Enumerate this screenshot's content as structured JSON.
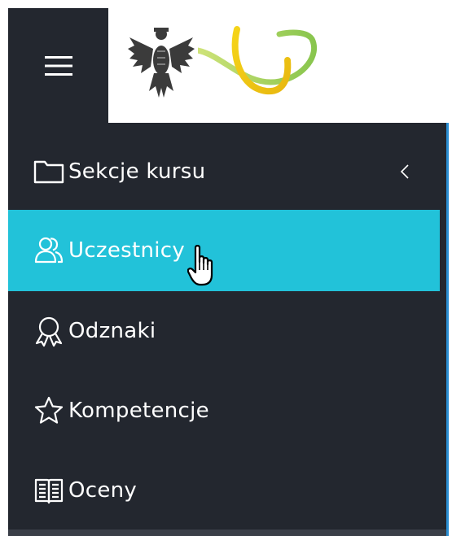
{
  "header": {
    "menu_toggle": "hamburger-menu-icon"
  },
  "sidebar": {
    "items": [
      {
        "label": "Sekcje kursu",
        "icon": "folder-icon",
        "has_chevron": true
      },
      {
        "label": "Uczestnicy",
        "icon": "users-icon",
        "active": true
      },
      {
        "label": "Odznaki",
        "icon": "badge-icon"
      },
      {
        "label": "Kompetencje",
        "icon": "star-icon"
      },
      {
        "label": "Oceny",
        "icon": "book-icon"
      }
    ]
  },
  "colors": {
    "sidebar_bg": "#23272f",
    "active_bg": "#22c2d9",
    "accent_line": "#2a8fd4",
    "text": "#ffffff"
  }
}
